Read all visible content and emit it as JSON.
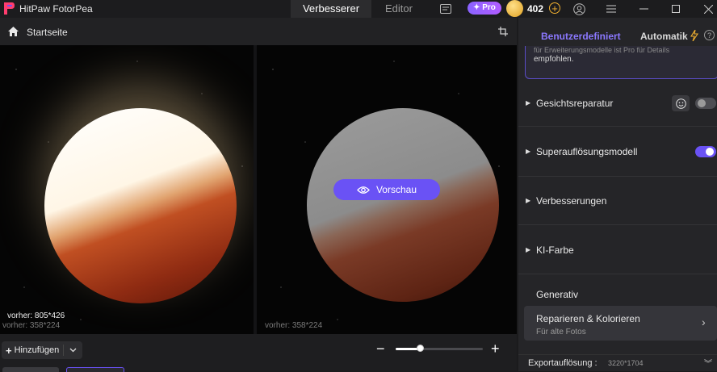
{
  "titlebar": {
    "app_title": "HitPaw FotorPea",
    "mode_tabs": {
      "enhancer": "Verbesserer",
      "editor": "Editor"
    },
    "pro_label": "Pro",
    "credits": "402"
  },
  "toolbar": {
    "home_label": "Startseite"
  },
  "canvas": {
    "before_size": "vorher: 805*426",
    "before_size_faded": "vorher: 358*224",
    "after_size_faded": "vorher: 358*224",
    "preview_label": "Vorschau"
  },
  "bottombar": {
    "add_label": "Hinzufügen",
    "zoom_level": 0.28
  },
  "panel": {
    "tab_custom": "Benutzerdefiniert",
    "tab_auto": "Automatik",
    "info_faded": "für Erweiterungsmodelle ist Pro für Details",
    "info_text": "empfohlen.",
    "sections": {
      "face": {
        "label": "Gesichtsreparatur",
        "enabled": false
      },
      "superres": {
        "label": "Superauflösungsmodell",
        "enabled": true
      },
      "enhance": {
        "label": "Verbesserungen"
      },
      "color": {
        "label": "KI-Farbe"
      }
    },
    "generative": {
      "title": "Generativ",
      "card_title": "Reparieren & Kolorieren",
      "card_subtitle": "Für alte Fotos"
    },
    "export": {
      "label": "Exportauflösung :",
      "value": "3220*1704"
    }
  },
  "colors": {
    "accent": "#6a52f5",
    "accent_text": "#8b78ff",
    "background": "#1b1b1d"
  }
}
